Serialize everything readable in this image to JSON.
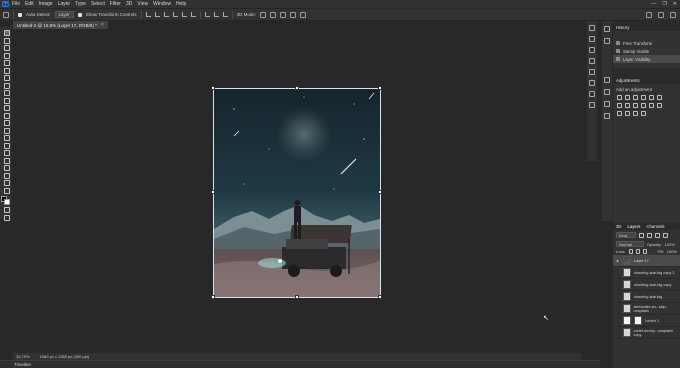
{
  "menu": {
    "items": [
      "File",
      "Edit",
      "Image",
      "Layer",
      "Type",
      "Select",
      "Filter",
      "3D",
      "View",
      "Window",
      "Help"
    ]
  },
  "window_controls": [
    "—",
    "❐",
    "✕"
  ],
  "options": {
    "auto_select_label": "Auto-Select:",
    "auto_select_value": "Layer",
    "show_transform_label": "Show Transform Controls",
    "mode_3d_label": "3D Mode:"
  },
  "document_tab": {
    "title": "Untitled-2 @ 16.8% (Layer 17, RGB/8) *",
    "close": "×"
  },
  "status": {
    "zoom": "16.79%",
    "doc_info": "1080 px x 1350 px (300 ppi)"
  },
  "timeline": {
    "label": "Timeline"
  },
  "history": {
    "tab": "History",
    "items": [
      {
        "label": "Free Transform",
        "selected": false
      },
      {
        "label": "Stamp Visible",
        "selected": false
      },
      {
        "label": "Layer Visibility",
        "selected": true
      }
    ]
  },
  "adjustments": {
    "tab": "Adjustments",
    "subtitle": "Add an adjustment"
  },
  "layers": {
    "tabs": [
      "3D",
      "Layers",
      "Channels"
    ],
    "active_tab": "Layers",
    "filter_value": "Kind",
    "blend_mode": "Normal",
    "opacity_label": "Opacity:",
    "opacity_value": "100%",
    "lock_label": "Lock:",
    "fill_label": "Fill:",
    "fill_value": "100%",
    "items": [
      {
        "name": "Layer 17",
        "selected": true,
        "visible": true
      },
      {
        "name": "shooting-star-big copy 2",
        "selected": false,
        "visible": false
      },
      {
        "name": "shooting-star-big copy",
        "selected": false,
        "visible": false
      },
      {
        "name": "shooting-star-big",
        "selected": false,
        "visible": false
      },
      {
        "name": "alexander-an...skip-unsplash",
        "selected": false,
        "visible": false
      },
      {
        "name": "Levels 1",
        "selected": false,
        "visible": false
      },
      {
        "name": "coriel-mcvey...unsplash copy",
        "selected": false,
        "visible": false
      }
    ]
  },
  "colors": {
    "accent": "#2b6ec4",
    "panel_bg": "#323232",
    "canvas_bg": "#282828",
    "selected_row": "#4b4b4b"
  }
}
